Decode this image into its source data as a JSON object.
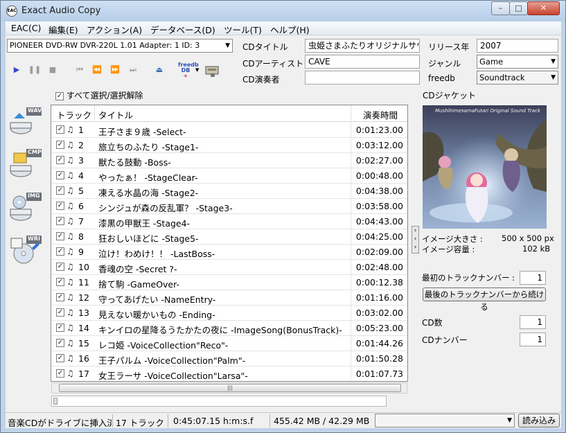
{
  "window": {
    "title": "Exact Audio Copy",
    "icon_label": "EAC"
  },
  "menu": [
    "EAC(C)",
    "編集(E)",
    "アクション(A)",
    "データベース(D)",
    "ツール(T)",
    "ヘルプ(H)"
  ],
  "drive": {
    "selected": "PIONEER DVD-RW  DVR-220L 1.01   Adapter: 1  ID: 3"
  },
  "toolbar": {
    "play": "play-icon",
    "pause": "pause-icon",
    "stop": "stop-icon",
    "prev_track": "prev-track-icon",
    "rewind": "rewind-icon",
    "fast_forward": "fast-forward-icon",
    "next_track": "next-track-icon",
    "eject": "eject-icon",
    "freedb_top": "freedb",
    "freedb_bottom": "DB"
  },
  "cd_info": {
    "title_label": "CDタイトル",
    "title": "虫姫さまふたりオリジナルサウンドトラック",
    "artist_label": "CDアーティスト",
    "artist": "CAVE",
    "performer_label": "CD演奏者",
    "performer": "",
    "year_label": "リリース年",
    "year": "2007",
    "genre_label": "ジャンル",
    "genre": "Game",
    "freedb_label": "freedb",
    "freedb": "Soundtrack"
  },
  "sidebar": [
    {
      "label": "WAV",
      "icon": "copy-wav-icon"
    },
    {
      "label": "CMP",
      "icon": "compress-icon"
    },
    {
      "label": "IMG",
      "icon": "copy-image-icon"
    },
    {
      "label": "WRI",
      "icon": "write-cd-icon"
    }
  ],
  "select_all_label": "すべて選択/選択解除",
  "table": {
    "headers": {
      "track": "トラック",
      "title": "タイトル",
      "duration": "演奏時間"
    },
    "rows": [
      {
        "num": "1",
        "title": "王子さま９歳 -Select-",
        "duration": "0:01:23.00"
      },
      {
        "num": "2",
        "title": "旅立ちのふたり -Stage1-",
        "duration": "0:03:12.00"
      },
      {
        "num": "3",
        "title": "獣たる鼓動 -Boss-",
        "duration": "0:02:27.00"
      },
      {
        "num": "4",
        "title": "やったぁ！ -StageClear-",
        "duration": "0:00:48.00"
      },
      {
        "num": "5",
        "title": "凍える水晶の海 -Stage2-",
        "duration": "0:04:38.00"
      },
      {
        "num": "6",
        "title": "シンジュが森の反乱軍？ -Stage3-",
        "duration": "0:03:58.00"
      },
      {
        "num": "7",
        "title": "漆黒の甲獣王 -Stage4-",
        "duration": "0:04:43.00"
      },
      {
        "num": "8",
        "title": "狂おしいほどに -Stage5-",
        "duration": "0:04:25.00"
      },
      {
        "num": "9",
        "title": "泣け！わめけ！！ -LastBoss-",
        "duration": "0:02:09.00"
      },
      {
        "num": "10",
        "title": "香魂の空 -Secret ?-",
        "duration": "0:02:48.00"
      },
      {
        "num": "11",
        "title": "捨て駒 -GameOver-",
        "duration": "0:00:12.38"
      },
      {
        "num": "12",
        "title": "守ってあげたい -NameEntry-",
        "duration": "0:01:16.00"
      },
      {
        "num": "13",
        "title": "見えない暖かいもの -Ending-",
        "duration": "0:03:02.00"
      },
      {
        "num": "14",
        "title": "キンイロの星降るうたかたの夜に -ImageSong(BonusTrack)-",
        "duration": "0:05:23.00"
      },
      {
        "num": "15",
        "title": "レコ姫 -VoiceCollection\"Reco\"-",
        "duration": "0:01:44.26"
      },
      {
        "num": "16",
        "title": "王子パルム -VoiceCollection\"Palm\"-",
        "duration": "0:01:50.28"
      },
      {
        "num": "17",
        "title": "女王ラーサ -VoiceCollection\"Larsa\"-",
        "duration": "0:01:07.73"
      }
    ]
  },
  "cover": {
    "label": "CDジャケット",
    "art_title": "MushihimesamaFutari Original Sound Track",
    "size_label": "イメージ大きさ :",
    "size": "500 x 500 px",
    "bytes_label": "イメージ容量 :",
    "bytes": "102 kB"
  },
  "numbering": {
    "first_track_label": "最初のトラックナンバー :",
    "first_track": "1",
    "continue_button": "最後のトラックナンバーから続ける",
    "cd_count_label": "CD数",
    "cd_count": "1",
    "cd_number_label": "CDナンバー",
    "cd_number": "1"
  },
  "status": {
    "message": "音楽CDがドライブに挿入済",
    "tracks": "17 トラック",
    "total_time": "0:45:07.15 h:m:s.f",
    "size": "455.42 MB / 42.29 MB",
    "load_button": "読み込み"
  },
  "colors": {
    "title_bar": "#bfd3ea",
    "play": "#3b44c8",
    "close": "#c7432f"
  }
}
